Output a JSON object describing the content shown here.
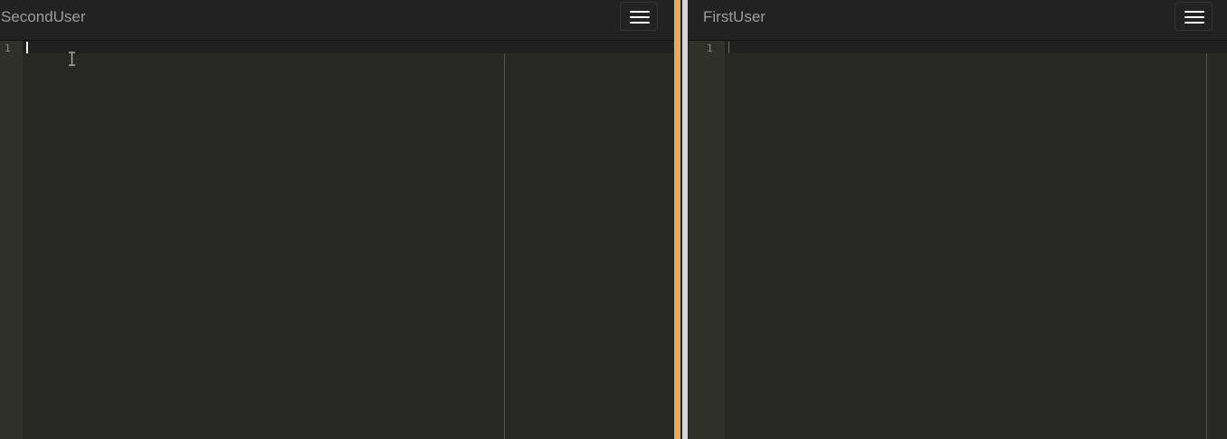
{
  "left_pane": {
    "user_name": "SecondUser",
    "line_numbers": [
      "1"
    ]
  },
  "right_pane": {
    "user_name": "FirstUser",
    "line_numbers": [
      "1"
    ]
  },
  "icons": {
    "menu": "hamburger-menu-icon",
    "pointer": "text-ibeam-cursor-icon"
  },
  "colors": {
    "editor_background": "#272822",
    "gutter_background": "#2f3129",
    "header_background": "#222222",
    "divider_accent": "#e8a95a"
  }
}
